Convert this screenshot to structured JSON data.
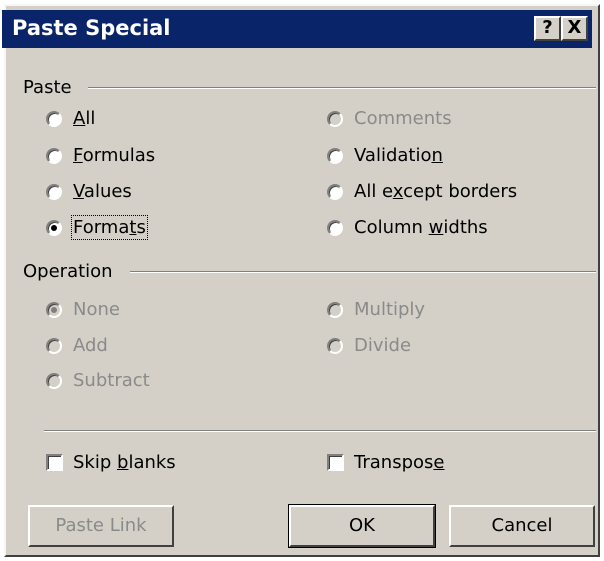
{
  "window": {
    "title": "Paste Special"
  },
  "titlebar_buttons": {
    "help": "?",
    "close": "X"
  },
  "paste": {
    "label": "Paste",
    "left": [
      {
        "pre": "",
        "u": "A",
        "post": "ll",
        "checked": false,
        "enabled": true
      },
      {
        "pre": "",
        "u": "F",
        "post": "ormulas",
        "checked": false,
        "enabled": true
      },
      {
        "pre": "",
        "u": "V",
        "post": "alues",
        "checked": false,
        "enabled": true
      },
      {
        "pre": "Forma",
        "u": "t",
        "post": "s",
        "checked": true,
        "enabled": true
      }
    ],
    "right": [
      {
        "pre": "",
        "u": "C",
        "post": "omments",
        "checked": false,
        "enabled": false
      },
      {
        "pre": "Validatio",
        "u": "n",
        "post": "",
        "checked": false,
        "enabled": true
      },
      {
        "pre": "All e",
        "u": "x",
        "post": "cept borders",
        "checked": false,
        "enabled": true
      },
      {
        "pre": "Column ",
        "u": "w",
        "post": "idths",
        "checked": false,
        "enabled": true
      }
    ]
  },
  "operation": {
    "label": "Operation",
    "left": [
      "None",
      "Add",
      "Subtract"
    ],
    "right": [
      "Multiply",
      "Divide"
    ],
    "selected": "None"
  },
  "options": {
    "skip_blanks": {
      "pre": "Skip ",
      "u": "b",
      "post": "lanks",
      "checked": false
    },
    "transpose": {
      "pre": "Transpos",
      "u": "e",
      "post": "",
      "checked": false
    }
  },
  "buttons": {
    "paste_link": "Paste Link",
    "ok": "OK",
    "cancel": "Cancel"
  }
}
